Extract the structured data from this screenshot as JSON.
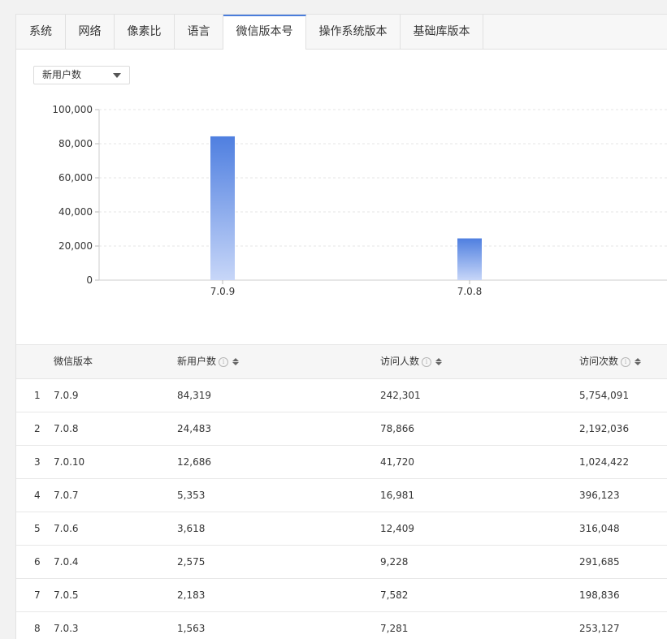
{
  "tabs": [
    "系统",
    "网络",
    "像素比",
    "语言",
    "微信版本号",
    "操作系统版本",
    "基础库版本"
  ],
  "active_tab": 4,
  "metric_select": {
    "value": "新用户数"
  },
  "chart_data": {
    "type": "bar",
    "categories": [
      "7.0.9",
      "7.0.8"
    ],
    "values": [
      84319,
      24483
    ],
    "ylim": [
      0,
      100000
    ],
    "yticks": [
      "0",
      "20,000",
      "40,000",
      "60,000",
      "80,000",
      "100,000"
    ],
    "grid": true,
    "colors": {
      "top": "#4f7fe0",
      "bottom": "#c7d6f8"
    }
  },
  "table": {
    "headers": [
      "微信版本",
      "新用户数",
      "访问人数",
      "访问次数"
    ],
    "rows": [
      [
        "1",
        "7.0.9",
        "84,319",
        "242,301",
        "5,754,091"
      ],
      [
        "2",
        "7.0.8",
        "24,483",
        "78,866",
        "2,192,036"
      ],
      [
        "3",
        "7.0.10",
        "12,686",
        "41,720",
        "1,024,422"
      ],
      [
        "4",
        "7.0.7",
        "5,353",
        "16,981",
        "396,123"
      ],
      [
        "5",
        "7.0.6",
        "3,618",
        "12,409",
        "316,048"
      ],
      [
        "6",
        "7.0.4",
        "2,575",
        "9,228",
        "291,685"
      ],
      [
        "7",
        "7.0.5",
        "2,183",
        "7,582",
        "198,836"
      ],
      [
        "8",
        "7.0.3",
        "1,563",
        "7,281",
        "253,127"
      ]
    ]
  }
}
